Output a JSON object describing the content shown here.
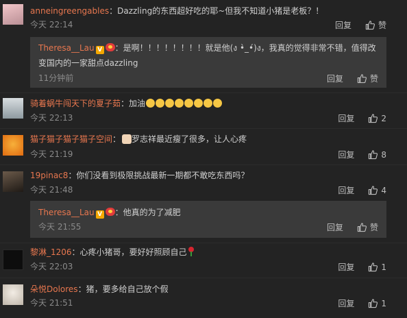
{
  "comments": [
    {
      "user": "anneingreengables",
      "text": "：Dazzling的东西超好吃的耶~但我不知道小猪是老板？！",
      "time": "今天 22:14",
      "reply_label": "回复",
      "like_label": "赞",
      "sub_reply": {
        "user": "Theresa__Lau",
        "text_line1": "：是啊！！！！！！！！就是他(ง •̀_•́)ง，我真的觉得非常不错，值得改",
        "text_line2": "变国内的一家甜点dazzling",
        "time": "11分钟前",
        "reply_label": "回复",
        "like_label": "赞"
      }
    },
    {
      "user": "骑着蜗牛闯天下的夏子茹",
      "text": "：加油",
      "time": "今天 22:13",
      "reply_label": "回复",
      "like_count": "2"
    },
    {
      "user": "猫子猫子猫子猫子空间",
      "text": "罗志祥最近瘦了很多，让人心疼",
      "prefix": "：",
      "time": "今天 21:19",
      "reply_label": "回复",
      "like_count": "8"
    },
    {
      "user": "19pinac8",
      "text": "：你们没看到极限挑战最新一期都不敢吃东西吗？",
      "time": "今天 21:48",
      "reply_label": "回复",
      "like_count": "4",
      "sub_reply": {
        "user": "Theresa__Lau",
        "text": "：他真的为了减肥",
        "time": "今天 21:55",
        "reply_label": "回复",
        "like_label": "赞"
      }
    },
    {
      "user": "黎淋_1206",
      "text": "：心疼小猪哥，要好好照顾自己",
      "time": "今天 22:03",
      "reply_label": "回复",
      "like_count": "1"
    },
    {
      "user": "朵悦Dolores",
      "text": "：猪，要多给自己放个假",
      "time": "今天 21:51",
      "reply_label": "回复",
      "like_count": "1"
    }
  ],
  "colors": {
    "background": "#232323",
    "username": "#e8774f",
    "subreply_bg": "#3a3a3a"
  }
}
